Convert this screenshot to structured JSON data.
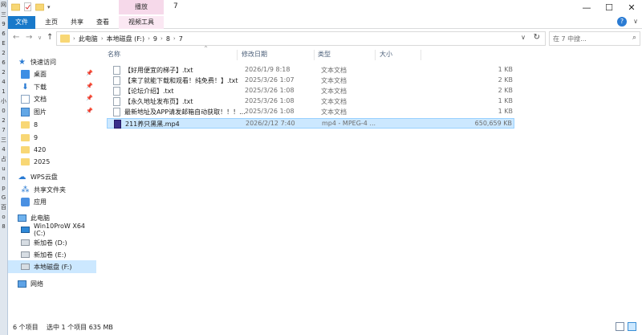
{
  "window": {
    "title": "7",
    "controls": {
      "minimize": "—",
      "maximize": "☐",
      "close": "✕"
    }
  },
  "ribbon": {
    "context_tab_header": "播放",
    "tabs": [
      "文件",
      "主页",
      "共享",
      "查看",
      "视频工具"
    ],
    "help": "?",
    "expand": "∨"
  },
  "address": {
    "crumbs": [
      "此电脑",
      "本地磁盘 (F:)",
      "9",
      "8",
      "7"
    ],
    "search_placeholder": "在 7 中搜..."
  },
  "nav": {
    "quick_access": "快速访问",
    "items": [
      {
        "label": "桌面",
        "icon": "desktop-icon",
        "pinned": true
      },
      {
        "label": "下载",
        "icon": "download-icon",
        "pinned": true
      },
      {
        "label": "文档",
        "icon": "documents-icon",
        "pinned": true
      },
      {
        "label": "图片",
        "icon": "pictures-icon",
        "pinned": true
      },
      {
        "label": "8",
        "icon": "folder-icon",
        "pinned": false
      },
      {
        "label": "9",
        "icon": "folder-icon",
        "pinned": false
      },
      {
        "label": "420",
        "icon": "folder-icon",
        "pinned": false
      },
      {
        "label": "2025",
        "icon": "folder-icon",
        "pinned": false
      }
    ],
    "wps": "WPS云盘",
    "wps_items": [
      "共享文件夹",
      "应用"
    ],
    "this_pc": "此电脑",
    "drives": [
      "Win10ProW X64 (C:)",
      "新加卷 (D:)",
      "新加卷 (E:)",
      "本地磁盘 (F:)"
    ],
    "network": "网络"
  },
  "columns": {
    "name": "名称",
    "date": "修改日期",
    "type": "类型",
    "size": "大小"
  },
  "files": [
    {
      "name": "【好用便宜的梯子】.txt",
      "date": "2026/1/9 8:18",
      "type": "文本文档",
      "size": "1 KB",
      "icon": "text-file-icon"
    },
    {
      "name": "【来了就能下载和观看！纯免费！】.txt",
      "date": "2025/3/26 1:07",
      "type": "文本文档",
      "size": "2 KB",
      "icon": "text-file-icon"
    },
    {
      "name": "【论坛介绍】.txt",
      "date": "2025/3/26 1:08",
      "type": "文本文档",
      "size": "2 KB",
      "icon": "text-file-icon"
    },
    {
      "name": "【永久地址发布页】.txt",
      "date": "2025/3/26 1:08",
      "type": "文本文档",
      "size": "1 KB",
      "icon": "text-file-icon"
    },
    {
      "name": "最新地址及APP请发邮箱自动获取！！！...",
      "date": "2025/3/26 1:08",
      "type": "文本文档",
      "size": "1 KB",
      "icon": "text-file-icon"
    },
    {
      "name": "211养只黑黑.mp4",
      "date": "2026/2/12 7:40",
      "type": "mp4 - MPEG-4 ...",
      "size": "650,659 KB",
      "icon": "video-file-icon"
    }
  ],
  "status": {
    "count": "6 个项目",
    "selected": "选中 1 个项目  635 MB"
  },
  "desktop_strip": [
    "网",
    "三",
    "9",
    "6",
    "E",
    "2",
    "6",
    "2",
    "4",
    "1",
    "小",
    "0",
    "2",
    "7",
    "三",
    "4",
    "占",
    "u",
    "n",
    "p",
    "G",
    "百",
    "o",
    "8"
  ]
}
